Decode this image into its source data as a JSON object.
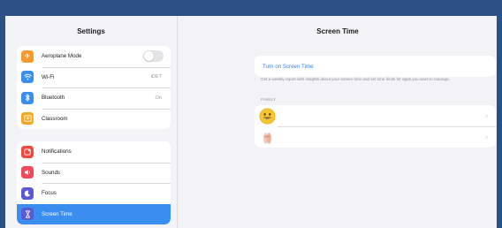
{
  "sidebar": {
    "title": "Settings",
    "group1": [
      {
        "label": "Aeroplane Mode",
        "icon": "airplane-icon",
        "color": "#f79a2e",
        "glyph": "✈",
        "toggle": false
      },
      {
        "label": "Wi-Fi",
        "icon": "wifi-icon",
        "color": "#3a8ef0",
        "glyph": "≋",
        "value": "iDET"
      },
      {
        "label": "Bluetooth",
        "icon": "bluetooth-icon",
        "color": "#3a8ef0",
        "glyph": "ᛒ",
        "value": "On"
      },
      {
        "label": "Classroom",
        "icon": "classroom-icon",
        "color": "#f5a623",
        "glyph": "▣"
      }
    ],
    "group2": [
      {
        "label": "Notifications",
        "icon": "notifications-icon",
        "color": "#f04a3e",
        "glyph": "▤"
      },
      {
        "label": "Sounds",
        "icon": "sounds-icon",
        "color": "#f04a5a",
        "glyph": "◀"
      },
      {
        "label": "Focus",
        "icon": "focus-icon",
        "color": "#5a5ad6",
        "glyph": "☾"
      },
      {
        "label": "Screen Time",
        "icon": "hourglass-icon",
        "color": "#5a5ad6",
        "glyph": "⌛",
        "selected": true
      }
    ]
  },
  "detail": {
    "title": "Screen Time",
    "turn_on_label": "Turn on Screen Time",
    "note": "Get a weekly report with insights about your screen time and set time limits for apps you want to manage.",
    "family_label": "FAMILY",
    "members": [
      {
        "avatar": "smiling-face-avatar"
      },
      {
        "avatar": "hands-avatar"
      }
    ]
  },
  "colors": {
    "accent": "#3a8ef0",
    "link": "#2f7fe0",
    "frame": "#2c4f86"
  }
}
